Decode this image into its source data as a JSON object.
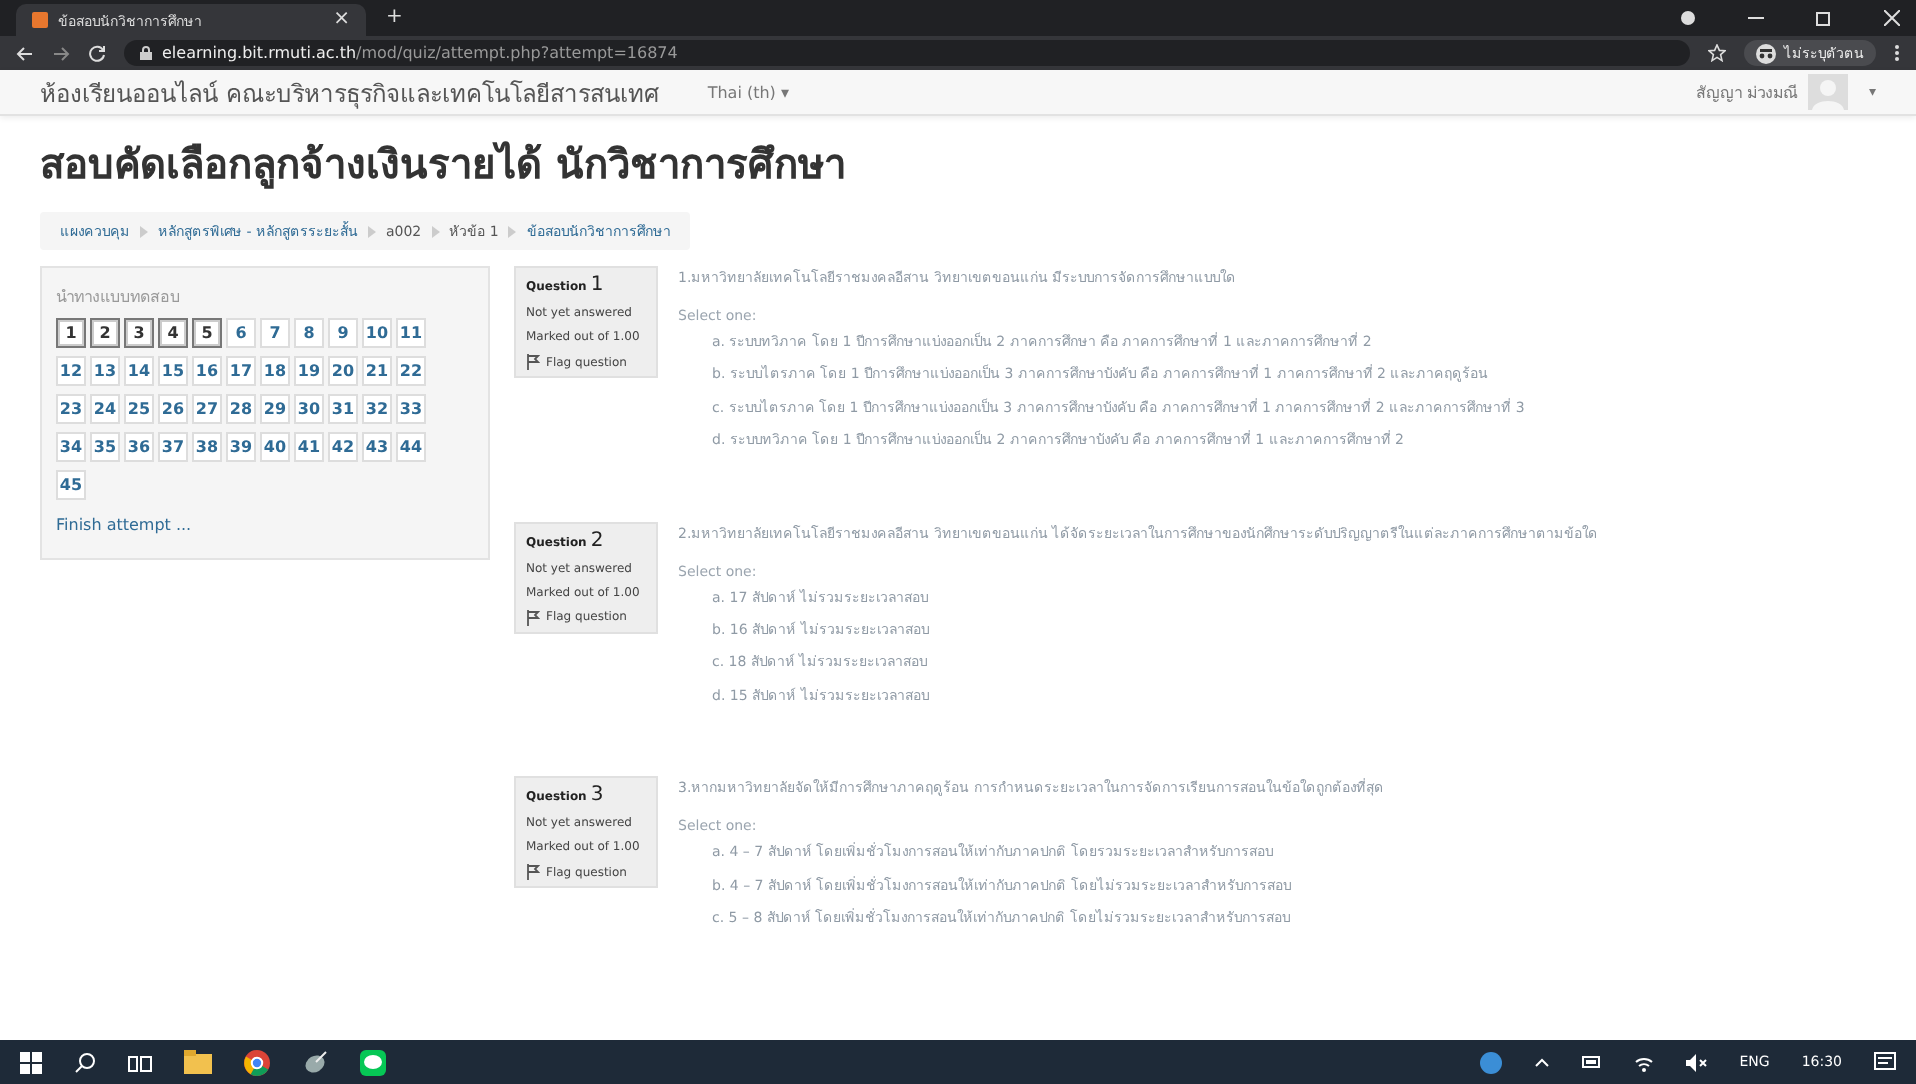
{
  "browser": {
    "tab_title": "ข้อสอบนักวิชาการศึกษา",
    "tab_close": "×",
    "new_tab": "+",
    "url_host": "elearning.bit.rmuti.ac.th",
    "url_path": "/mod/quiz/attempt.php?attempt=16874",
    "profile": "ไม่ระบุตัวตน"
  },
  "navbar": {
    "site_name": "ห้องเรียนออนไลน์ คณะบริหารธุรกิจและเทคโนโลยีสารสนเทศ",
    "language": "Thai (th) ▾",
    "user_name": "สัญญา ม่วงมณี",
    "user_menu": "▾"
  },
  "page_title": "สอบคัดเลือกลูกจ้างเงินรายได้ นักวิชาการศึกษา",
  "breadcrumb": [
    "แผงควบคุม",
    "หลักสูตรพิเศษ - หลักสูตรระยะสั้น",
    "a002",
    "หัวข้อ 1",
    "ข้อสอบนักวิชาการศึกษา"
  ],
  "quiz_navigation": {
    "title": "นำทางแบบทดสอบ",
    "finish": "Finish attempt ...",
    "buttons": [
      {
        "label": "1",
        "on_page": true
      },
      {
        "label": "2",
        "on_page": true
      },
      {
        "label": "3",
        "on_page": true
      },
      {
        "label": "4",
        "on_page": true
      },
      {
        "label": "5",
        "on_page": true
      },
      {
        "label": "6",
        "on_page": false
      },
      {
        "label": "7",
        "on_page": false
      },
      {
        "label": "8",
        "on_page": false
      },
      {
        "label": "9",
        "on_page": false
      },
      {
        "label": "10",
        "on_page": false
      },
      {
        "label": "11",
        "on_page": false
      },
      {
        "label": "12",
        "on_page": false
      },
      {
        "label": "13",
        "on_page": false
      },
      {
        "label": "14",
        "on_page": false
      },
      {
        "label": "15",
        "on_page": false
      },
      {
        "label": "16",
        "on_page": false
      },
      {
        "label": "17",
        "on_page": false
      },
      {
        "label": "18",
        "on_page": false
      },
      {
        "label": "19",
        "on_page": false
      },
      {
        "label": "20",
        "on_page": false
      },
      {
        "label": "21",
        "on_page": false
      },
      {
        "label": "22",
        "on_page": false
      },
      {
        "label": "23",
        "on_page": false
      },
      {
        "label": "24",
        "on_page": false
      },
      {
        "label": "25",
        "on_page": false
      },
      {
        "label": "26",
        "on_page": false
      },
      {
        "label": "27",
        "on_page": false
      },
      {
        "label": "28",
        "on_page": false
      },
      {
        "label": "29",
        "on_page": false
      },
      {
        "label": "30",
        "on_page": false
      },
      {
        "label": "31",
        "on_page": false
      },
      {
        "label": "32",
        "on_page": false
      },
      {
        "label": "33",
        "on_page": false
      },
      {
        "label": "34",
        "on_page": false
      },
      {
        "label": "35",
        "on_page": false
      },
      {
        "label": "36",
        "on_page": false
      },
      {
        "label": "37",
        "on_page": false
      },
      {
        "label": "38",
        "on_page": false
      },
      {
        "label": "39",
        "on_page": false
      },
      {
        "label": "40",
        "on_page": false
      },
      {
        "label": "41",
        "on_page": false
      },
      {
        "label": "42",
        "on_page": false
      },
      {
        "label": "43",
        "on_page": false
      },
      {
        "label": "44",
        "on_page": false
      },
      {
        "label": "45",
        "on_page": false
      }
    ]
  },
  "questions": [
    {
      "label": "Question",
      "number": "1",
      "status": "Not yet answered",
      "marks": "Marked out of 1.00",
      "flag": "Flag question",
      "text": "1.มหาวิทยาลัยเทคโนโลยีราชมงคลอีสาน วิทยาเขตขอนแก่น มีระบบการจัดการศึกษาแบบใด",
      "prompt": "Select one:",
      "options": [
        "a. ระบบทวิภาค โดย 1 ปีการศึกษาแบ่งออกเป็น 2 ภาคการศึกษา คือ ภาคการศึกษาที่ 1 และภาคการศึกษาที่ 2",
        "b. ระบบไตรภาค โดย 1 ปีการศึกษาแบ่งออกเป็น 3 ภาคการศึกษาบังคับ คือ ภาคการศึกษาที่ 1 ภาคการศึกษาที่ 2 และภาคฤดูร้อน",
        "c. ระบบไตรภาค โดย 1 ปีการศึกษาแบ่งออกเป็น 3 ภาคการศึกษาบังคับ คือ ภาคการศึกษาที่ 1 ภาคการศึกษาที่ 2 และภาคการศึกษาที่ 3",
        "d. ระบบทวิภาค โดย 1 ปีการศึกษาแบ่งออกเป็น 2 ภาคการศึกษาบังคับ คือ ภาคการศึกษาที่ 1 และภาคการศึกษาที่ 2"
      ]
    },
    {
      "label": "Question",
      "number": "2",
      "status": "Not yet answered",
      "marks": "Marked out of 1.00",
      "flag": "Flag question",
      "text": "2.มหาวิทยาลัยเทคโนโลยีราชมงคลอีสาน วิทยาเขตขอนแก่น ได้จัดระยะเวลาในการศึกษาของนักศึกษาระดับปริญญาตรีในแต่ละภาคการศึกษาตามข้อใด",
      "prompt": "Select one:",
      "options": [
        "a. 17 สัปดาห์ ไม่รวมระยะเวลาสอบ",
        "b. 16 สัปดาห์ ไม่รวมระยะเวลาสอบ",
        "c. 18 สัปดาห์ ไม่รวมระยะเวลาสอบ",
        "d. 15 สัปดาห์ ไม่รวมระยะเวลาสอบ"
      ]
    },
    {
      "label": "Question",
      "number": "3",
      "status": "Not yet answered",
      "marks": "Marked out of 1.00",
      "flag": "Flag question",
      "text": "3.หากมหาวิทยาลัยจัดให้มีการศึกษาภาคฤดูร้อน การกำหนดระยะเวลาในการจัดการเรียนการสอนในข้อใดถูกต้องที่สุด",
      "prompt": "Select one:",
      "options": [
        "a. 4 – 7 สัปดาห์ โดยเพิ่มชั่วโมงการสอนให้เท่ากับภาคปกติ โดยรวมระยะเวลาสำหรับการสอบ",
        "b. 4 – 7 สัปดาห์ โดยเพิ่มชั่วโมงการสอนให้เท่ากับภาคปกติ โดยไม่รวมระยะเวลาสำหรับการสอบ",
        "c. 5 – 8 สัปดาห์ โดยเพิ่มชั่วโมงการสอนให้เท่ากับภาคปกติ โดยไม่รวมระยะเวลาสำหรับการสอบ"
      ]
    }
  ],
  "taskbar": {
    "language": "ENG",
    "time": "16:30"
  }
}
